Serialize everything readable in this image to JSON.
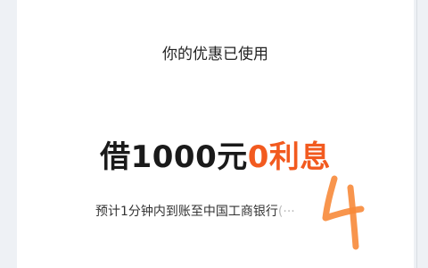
{
  "card": {
    "title": "你的优惠已使用",
    "headline_main": "借1000元",
    "headline_accent": "0利息",
    "eta_text": "预计1分钟内到账至中国工商银行",
    "eta_tail": "(···"
  },
  "colors": {
    "accent": "#f25a1f",
    "scribble": "#f78a3a"
  }
}
